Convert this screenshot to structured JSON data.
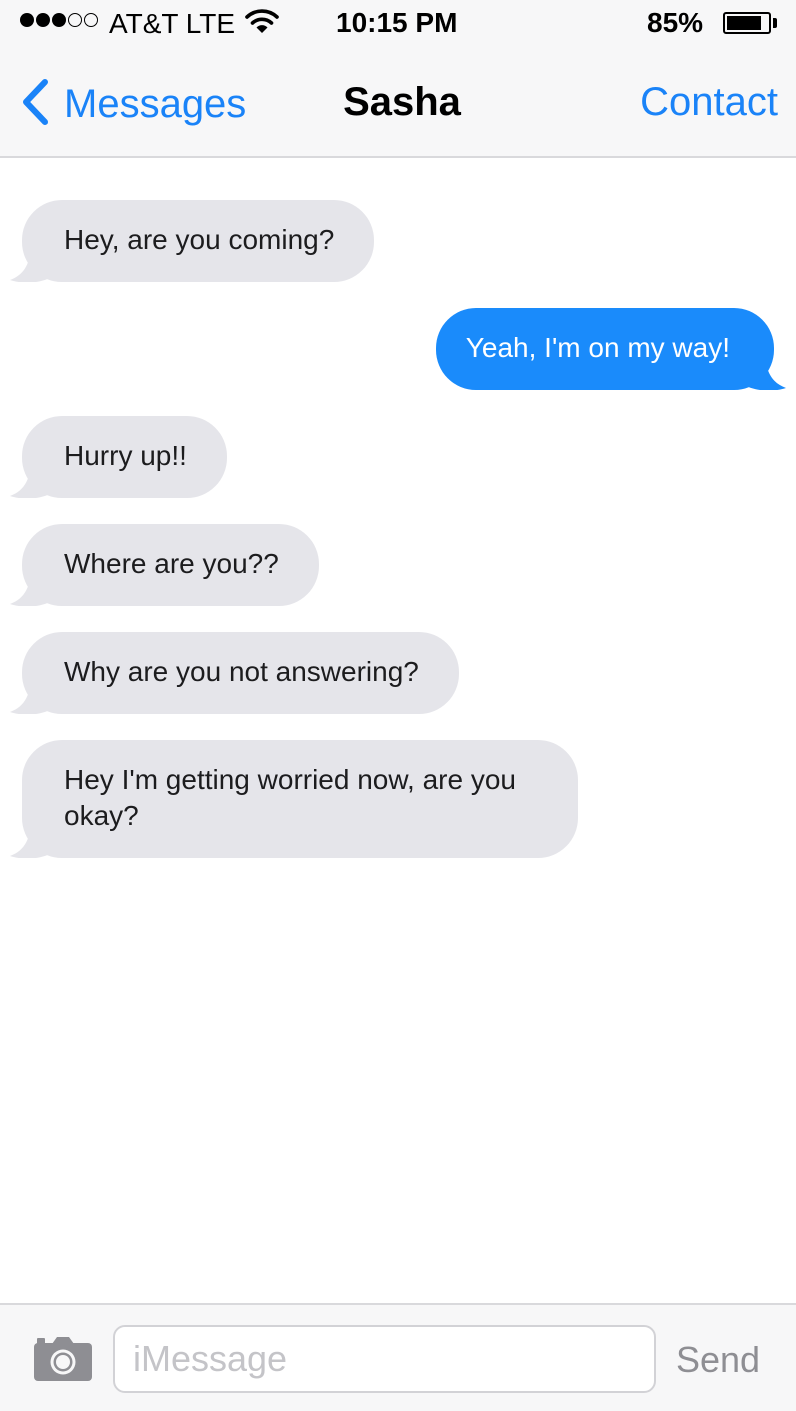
{
  "status_bar": {
    "carrier": "AT&T LTE",
    "signal_bars_filled": 3,
    "signal_bars_total": 5,
    "time": "10:15 PM",
    "battery_percent": "85%",
    "battery_level": 0.85
  },
  "nav": {
    "back_label": "Messages",
    "title": "Sasha",
    "action_label": "Contact"
  },
  "messages": [
    {
      "direction": "received",
      "text": "Hey, are you coming?"
    },
    {
      "direction": "sent",
      "text": "Yeah, I'm on my way!"
    },
    {
      "direction": "received",
      "text": "Hurry up!!"
    },
    {
      "direction": "received",
      "text": "Where are you??"
    },
    {
      "direction": "received",
      "text": "Why are you not answering?"
    },
    {
      "direction": "received",
      "text": "Hey I'm getting worried now, are you okay?"
    }
  ],
  "input": {
    "placeholder": "iMessage",
    "value": "",
    "send_label": "Send"
  },
  "colors": {
    "accent": "#1a83f8",
    "sent_bubble": "#1a8bfb",
    "received_bubble": "#e5e5ea",
    "bar_background": "#f7f7f8",
    "send_disabled": "#8e8e93"
  },
  "icons": {
    "back": "chevron-left-icon",
    "wifi": "wifi-icon",
    "battery": "battery-icon",
    "camera": "camera-icon"
  }
}
